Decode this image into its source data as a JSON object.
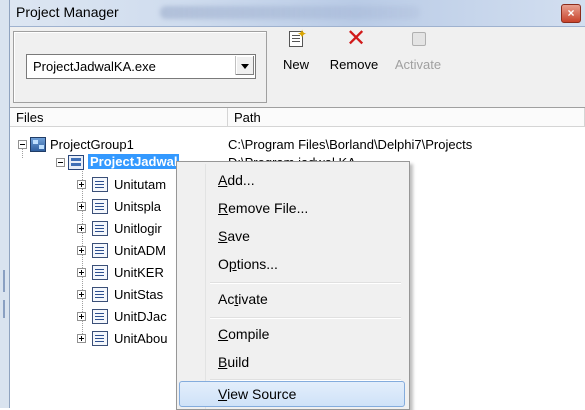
{
  "window": {
    "title": "Project Manager",
    "close_glyph": "×",
    "close_icon": "close-icon"
  },
  "toolbar": {
    "project_selector": {
      "value": "ProjectJadwalKA.exe",
      "arrow_icon": "chevron-down-icon"
    },
    "buttons": [
      {
        "label": "New",
        "icon": "new-file-icon",
        "enabled": true
      },
      {
        "label": "Remove",
        "icon": "remove-x-icon",
        "enabled": true
      },
      {
        "label": "Activate",
        "icon": "activate-icon",
        "enabled": false
      }
    ],
    "remove_glyph": "✕",
    "new_star": "✦"
  },
  "columns": {
    "files": "Files",
    "path": "Path"
  },
  "tree": {
    "group": {
      "name": "ProjectGroup1",
      "path": "C:\\Program Files\\Borland\\Delphi7\\Projects"
    },
    "project": {
      "name": "ProjectJadwal",
      "path": "D:\\Program jadwal KA"
    },
    "units": [
      {
        "name": "Unitutam"
      },
      {
        "name": "Unitspla"
      },
      {
        "name": "Unitlogir"
      },
      {
        "name": "UnitADM"
      },
      {
        "name": "UnitKER"
      },
      {
        "name": "UnitStas"
      },
      {
        "name": "UnitDJac"
      },
      {
        "name": "UnitAbou"
      }
    ]
  },
  "context_menu": {
    "items": [
      {
        "pre": "",
        "acc": "A",
        "post": "dd..."
      },
      {
        "pre": "",
        "acc": "R",
        "post": "emove File..."
      },
      {
        "pre": "",
        "acc": "S",
        "post": "ave"
      },
      {
        "pre": "O",
        "acc": "p",
        "post": "tions..."
      },
      {
        "pre": "Ac",
        "acc": "t",
        "post": "ivate"
      },
      {
        "pre": "",
        "acc": "C",
        "post": "ompile"
      },
      {
        "pre": "",
        "acc": "B",
        "post": "uild"
      },
      {
        "pre": "",
        "acc": "V",
        "post": "iew Source",
        "highlighted": true
      }
    ]
  },
  "colors": {
    "selection": "#3399ff",
    "menu_hover_border": "#84acdd",
    "remove_icon": "#d11a1a"
  }
}
